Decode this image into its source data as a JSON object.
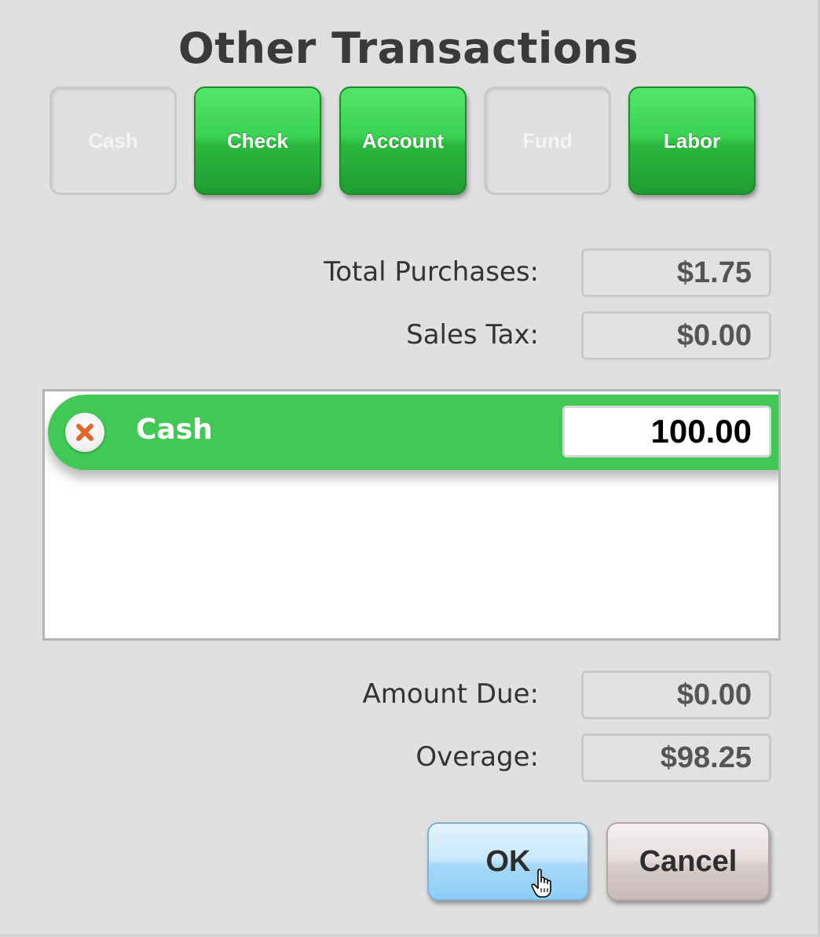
{
  "dialog": {
    "title": "Other Transactions"
  },
  "tender_types": [
    {
      "label": "Cash",
      "state": "inactive"
    },
    {
      "label": "Check",
      "state": "active"
    },
    {
      "label": "Account",
      "state": "active"
    },
    {
      "label": "Fund",
      "state": "inactive"
    },
    {
      "label": "Labor",
      "state": "active"
    }
  ],
  "summary": {
    "total_purchases": {
      "label": "Total Purchases:",
      "value": "$1.75"
    },
    "sales_tax": {
      "label": "Sales Tax:",
      "value": "$0.00"
    },
    "amount_due": {
      "label": "Amount Due:",
      "value": "$0.00"
    },
    "overage": {
      "label": "Overage:",
      "value": "$98.25"
    }
  },
  "tenders": [
    {
      "label": "Cash",
      "amount": "100.00"
    }
  ],
  "actions": {
    "ok_label": "OK",
    "cancel_label": "Cancel"
  },
  "colors": {
    "accent_green": "#42c955",
    "ok_blue": "#a8d9f8",
    "remove_x": "#e2662e"
  },
  "icons": {
    "remove": "remove-icon",
    "cursor": "hand-pointer-cursor"
  }
}
